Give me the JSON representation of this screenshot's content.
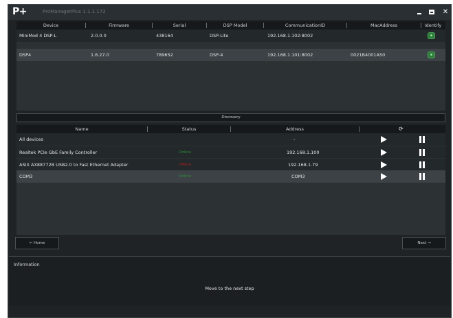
{
  "window": {
    "logo": "P+",
    "title": "ProManagerPlus 1.1.1.172",
    "minimize_icon": "minimize-icon",
    "maximize_icon": "maximize-icon",
    "close_icon": "close-icon"
  },
  "devices": {
    "columns": [
      "Device",
      "Firmware",
      "Serial",
      "DSP Model",
      "CommunicationID",
      "MacAddress",
      "Identify"
    ],
    "rows": [
      {
        "device": "MiniMod 4 DSP-L",
        "firmware": "2.0.0.0",
        "serial": "438164",
        "dsp_model": "DSP-Lite",
        "communication_id": "192.168.1.102:8002",
        "mac_address": ""
      },
      {
        "device": "DSP4",
        "firmware": "1.6.27.0",
        "serial": "789652",
        "dsp_model": "DSP-4",
        "communication_id": "192.168.1.101:8002",
        "mac_address": "0021B4001A50"
      }
    ]
  },
  "discovery": {
    "label": "Discovery"
  },
  "networks": {
    "columns": [
      "Name",
      "Status",
      "Address"
    ],
    "refresh_icon": "refresh-icon",
    "rows": [
      {
        "name": "All devices",
        "status": "",
        "address": "-"
      },
      {
        "name": "Realtek PCIe GbE Family Controller",
        "status": "Online",
        "address": "192.168.1.100"
      },
      {
        "name": "ASIX AX88772B USB2.0 to Fast Ethernet Adapter",
        "status": "Offline",
        "address": "192.168.1.79"
      },
      {
        "name": "COM3",
        "status": "Online",
        "address": "COM3"
      }
    ],
    "colors": {
      "online": "#2f8f3a",
      "offline": "#b01e1e"
    }
  },
  "navigation": {
    "home_label": "← Home",
    "next_label": "Next →"
  },
  "information": {
    "title": "Information",
    "message": "Move to the next step"
  }
}
